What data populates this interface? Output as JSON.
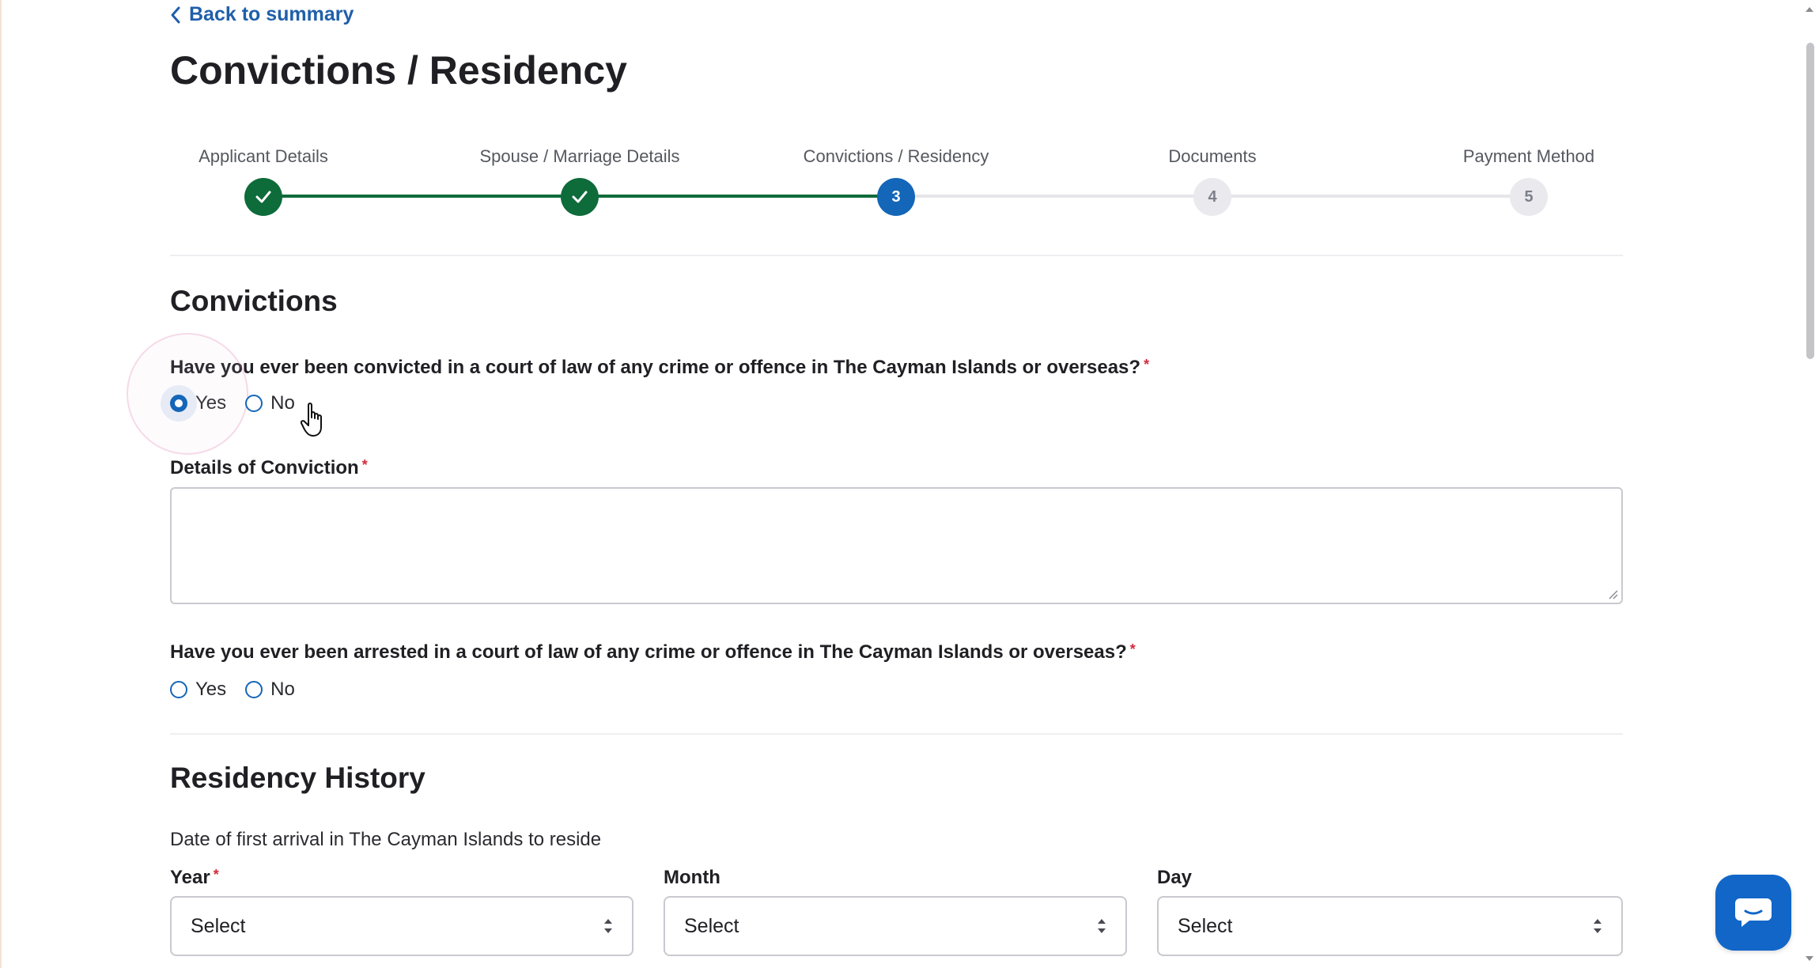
{
  "nav": {
    "back_label": "Back to summary"
  },
  "page": {
    "title": "Convictions / Residency"
  },
  "stepper": {
    "steps": [
      {
        "label": "Applicant Details",
        "marker": "",
        "state": "complete"
      },
      {
        "label": "Spouse / Marriage Details",
        "marker": "",
        "state": "complete"
      },
      {
        "label": "Convictions / Residency",
        "marker": "3",
        "state": "current"
      },
      {
        "label": "Documents",
        "marker": "4",
        "state": "upcoming"
      },
      {
        "label": "Payment Method",
        "marker": "5",
        "state": "upcoming"
      }
    ]
  },
  "convictions": {
    "title": "Convictions",
    "q1": {
      "text": "Have you ever been convicted in a court of law of any crime or offence in The Cayman Islands or overseas?",
      "required_mark": "*",
      "yes": "Yes",
      "no": "No",
      "selected": "Yes"
    },
    "details": {
      "label": "Details of Conviction",
      "required_mark": "*",
      "value": ""
    },
    "q2": {
      "text": "Have you ever been arrested in a court of law of any crime or offence in The Cayman Islands or overseas?",
      "required_mark": "*",
      "yes": "Yes",
      "no": "No",
      "selected": ""
    }
  },
  "residency": {
    "title": "Residency History",
    "intro": "Date of first arrival in The Cayman Islands to reside",
    "year": {
      "label": "Year",
      "required_mark": "*",
      "value": "Select"
    },
    "month": {
      "label": "Month",
      "value": "Select"
    },
    "day": {
      "label": "Day",
      "value": "Select"
    }
  },
  "colors": {
    "accent": "#1466b8",
    "success": "#0e6b3a",
    "required": "#d22b3b",
    "chat": "#1166c8"
  },
  "icons": {
    "back": "chevron-left-icon",
    "check": "check-icon",
    "select": "select-arrows-icon",
    "chat": "chat-bubble-icon",
    "cursor": "hand-pointer-icon"
  }
}
